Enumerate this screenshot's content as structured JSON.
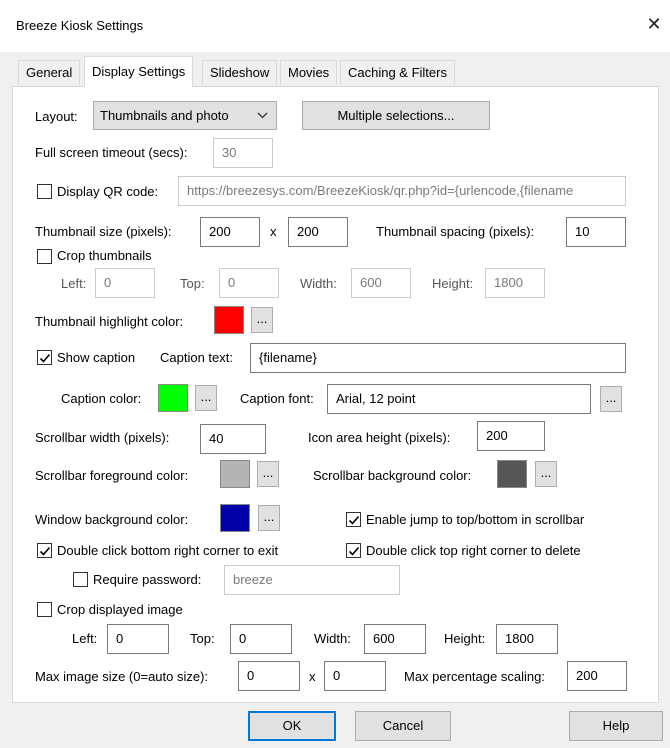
{
  "window": {
    "title": "Breeze Kiosk Settings"
  },
  "tabs": [
    {
      "label": "General"
    },
    {
      "label": "Display Settings"
    },
    {
      "label": "Slideshow"
    },
    {
      "label": "Movies"
    },
    {
      "label": "Caching & Filters"
    }
  ],
  "layout": {
    "label": "Layout:",
    "value": "Thumbnails and photo",
    "multiple_button": "Multiple selections..."
  },
  "fullscreen": {
    "label": "Full screen timeout (secs):",
    "value": "30"
  },
  "qr": {
    "label": "Display QR code:",
    "checked": false,
    "value": "https://breezesys.com/BreezeKiosk/qr.php?id={urlencode,{filename"
  },
  "thumb": {
    "size_label": "Thumbnail size (pixels):",
    "width": "200",
    "x": "x",
    "height": "200",
    "spacing_label": "Thumbnail spacing (pixels):",
    "spacing": "10",
    "crop_label": "Crop thumbnails",
    "crop_checked": false,
    "left_label": "Left:",
    "left": "0",
    "top_label": "Top:",
    "top": "0",
    "width_label": "Width:",
    "width_val": "600",
    "height_label": "Height:",
    "height_val": "1800",
    "highlight_label": "Thumbnail highlight color:",
    "highlight_color": "#ff0000",
    "ellipsis": "..."
  },
  "caption": {
    "show_label": "Show caption",
    "show_checked": true,
    "text_label": "Caption text:",
    "text": "{filename}",
    "color_label": "Caption color:",
    "color": "#00ff00",
    "font_label": "Caption font:",
    "font": "Arial, 12 point",
    "ellipsis": "..."
  },
  "scrollbar": {
    "width_label": "Scrollbar width (pixels):",
    "width": "40",
    "icon_label": "Icon area height (pixels):",
    "icon_height": "200",
    "fg_label": "Scrollbar foreground color:",
    "fg_color": "#b4b4b4",
    "bg_label": "Scrollbar background color:",
    "bg_color": "#555555",
    "ellipsis": "..."
  },
  "window_bg": {
    "label": "Window background color:",
    "color": "#0000a8",
    "ellipsis": "...",
    "jump_label": "Enable jump to top/bottom in scrollbar",
    "jump_checked": true
  },
  "exit": {
    "label": "Double click bottom right corner to exit",
    "checked": true,
    "delete_label": "Double click top right corner to delete",
    "delete_checked": true,
    "password_label": "Require password:",
    "password_checked": false,
    "password": "breeze"
  },
  "crop_image": {
    "label": "Crop displayed image",
    "checked": false,
    "left_label": "Left:",
    "left": "0",
    "top_label": "Top:",
    "top": "0",
    "width_label": "Width:",
    "width": "600",
    "height_label": "Height:",
    "height": "1800"
  },
  "max_image": {
    "label": "Max image size (0=auto size):",
    "w": "0",
    "x": "x",
    "h": "0",
    "scaling_label": "Max percentage scaling:",
    "scaling": "200"
  },
  "footer": {
    "ok": "OK",
    "cancel": "Cancel",
    "help": "Help"
  }
}
